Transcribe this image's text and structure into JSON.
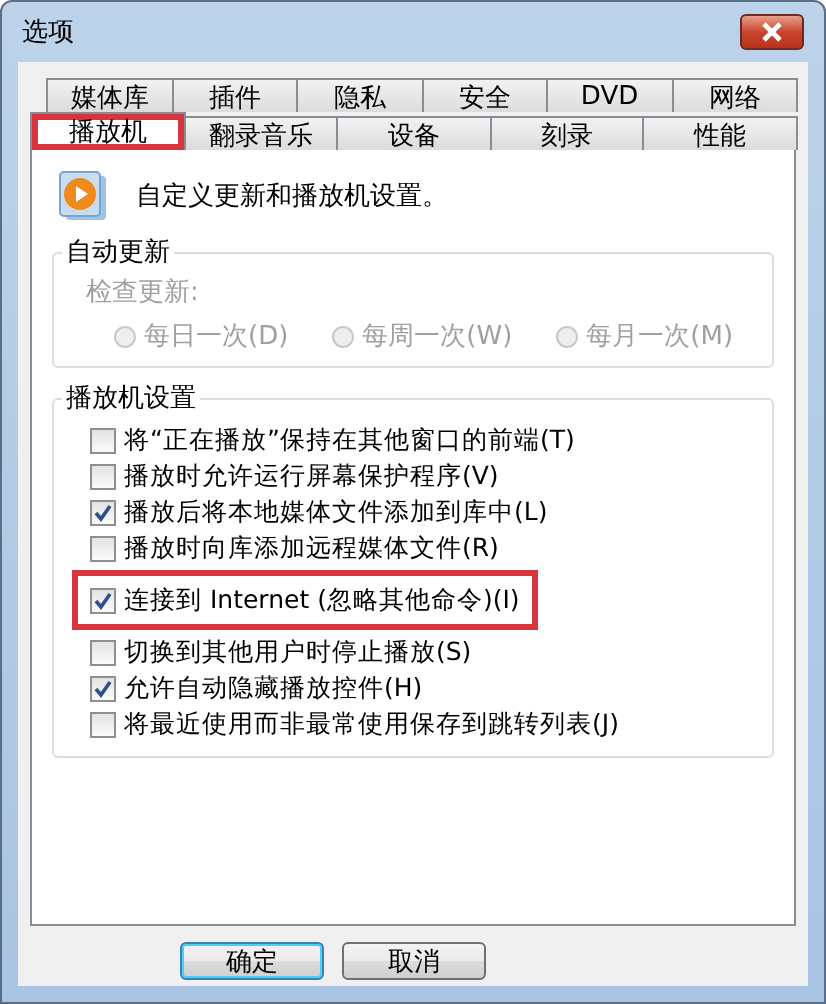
{
  "window": {
    "title": "选项"
  },
  "tab_rows": [
    [
      {
        "label": "媒体库",
        "selected": false,
        "highlighted": false
      },
      {
        "label": "插件",
        "selected": false,
        "highlighted": false
      },
      {
        "label": "隐私",
        "selected": false,
        "highlighted": false
      },
      {
        "label": "安全",
        "selected": false,
        "highlighted": false
      },
      {
        "label": "DVD",
        "selected": false,
        "highlighted": false
      },
      {
        "label": "网络",
        "selected": false,
        "highlighted": false
      }
    ],
    [
      {
        "label": "播放机",
        "selected": true,
        "highlighted": true
      },
      {
        "label": "翻录音乐",
        "selected": false,
        "highlighted": false
      },
      {
        "label": "设备",
        "selected": false,
        "highlighted": false
      },
      {
        "label": "刻录",
        "selected": false,
        "highlighted": false
      },
      {
        "label": "性能",
        "selected": false,
        "highlighted": false
      }
    ]
  ],
  "header": {
    "text": "自定义更新和播放机设置。"
  },
  "auto_update": {
    "title": "自动更新",
    "label": "检查更新:",
    "disabled": true,
    "options": [
      {
        "label": "每日一次(D)",
        "selected": false
      },
      {
        "label": "每周一次(W)",
        "selected": false
      },
      {
        "label": "每月一次(M)",
        "selected": false
      }
    ]
  },
  "player_settings": {
    "title": "播放机设置",
    "items": [
      {
        "label": "将“正在播放”保持在其他窗口的前端(T)",
        "checked": false,
        "highlighted": false
      },
      {
        "label": "播放时允许运行屏幕保护程序(V)",
        "checked": false,
        "highlighted": false
      },
      {
        "label": "播放后将本地媒体文件添加到库中(L)",
        "checked": true,
        "highlighted": false
      },
      {
        "label": "播放时向库添加远程媒体文件(R)",
        "checked": false,
        "highlighted": false
      },
      {
        "label": "连接到 Internet (忽略其他命令)(I)",
        "checked": true,
        "highlighted": true
      },
      {
        "label": "切换到其他用户时停止播放(S)",
        "checked": false,
        "highlighted": false
      },
      {
        "label": "允许自动隐藏播放控件(H)",
        "checked": true,
        "highlighted": false
      },
      {
        "label": "将最近使用而非最常使用保存到跳转列表(J)",
        "checked": false,
        "highlighted": false
      }
    ]
  },
  "buttons": [
    {
      "label": "确定",
      "default": true
    },
    {
      "label": "取消",
      "default": false
    }
  ]
}
